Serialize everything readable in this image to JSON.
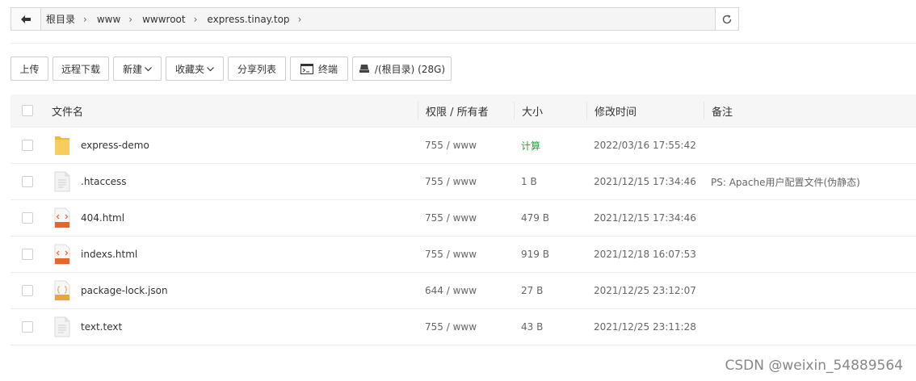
{
  "pathbar": {
    "crumbs": [
      {
        "label": "根目录"
      },
      {
        "label": "www"
      },
      {
        "label": "wwwroot"
      },
      {
        "label": "express.tinay.top"
      }
    ],
    "back_icon": "arrow-left-icon",
    "refresh_icon": "refresh-icon"
  },
  "toolbar": {
    "upload": "上传",
    "remote_download": "远程下载",
    "new": "新建",
    "favorites": "收藏夹",
    "share_list": "分享列表",
    "terminal": "终端",
    "disk": "/(根目录) (28G)"
  },
  "table": {
    "headers": {
      "name": "文件名",
      "perm": "权限 / 所有者",
      "size": "大小",
      "mtime": "修改时间",
      "note": "备注"
    },
    "rows": [
      {
        "type": "folder",
        "name": "express-demo",
        "perm": "755 / www",
        "size": "计算",
        "mtime": "2022/03/16 17:55:42",
        "note": ""
      },
      {
        "type": "text",
        "name": ".htaccess",
        "perm": "755 / www",
        "size": "1 B",
        "mtime": "2021/12/15 17:34:46",
        "note": "PS: Apache用户配置文件(伪静态)"
      },
      {
        "type": "html",
        "name": "404.html",
        "perm": "755 / www",
        "size": "479 B",
        "mtime": "2021/12/15 17:34:46",
        "note": ""
      },
      {
        "type": "html",
        "name": "indexs.html",
        "perm": "755 / www",
        "size": "919 B",
        "mtime": "2021/12/18 16:07:53",
        "note": ""
      },
      {
        "type": "json",
        "name": "package-lock.json",
        "perm": "644 / www",
        "size": "27 B",
        "mtime": "2021/12/25 23:12:07",
        "note": ""
      },
      {
        "type": "text",
        "name": "text.text",
        "perm": "755 / www",
        "size": "43 B",
        "mtime": "2021/12/25 23:11:28",
        "note": ""
      }
    ]
  },
  "colors": {
    "accent_green": "#20a53a",
    "folder": "#f5c553",
    "html_icon": "#e8652a",
    "json_icon": "#e8a73a"
  },
  "watermark": "CSDN @weixin_54889564"
}
